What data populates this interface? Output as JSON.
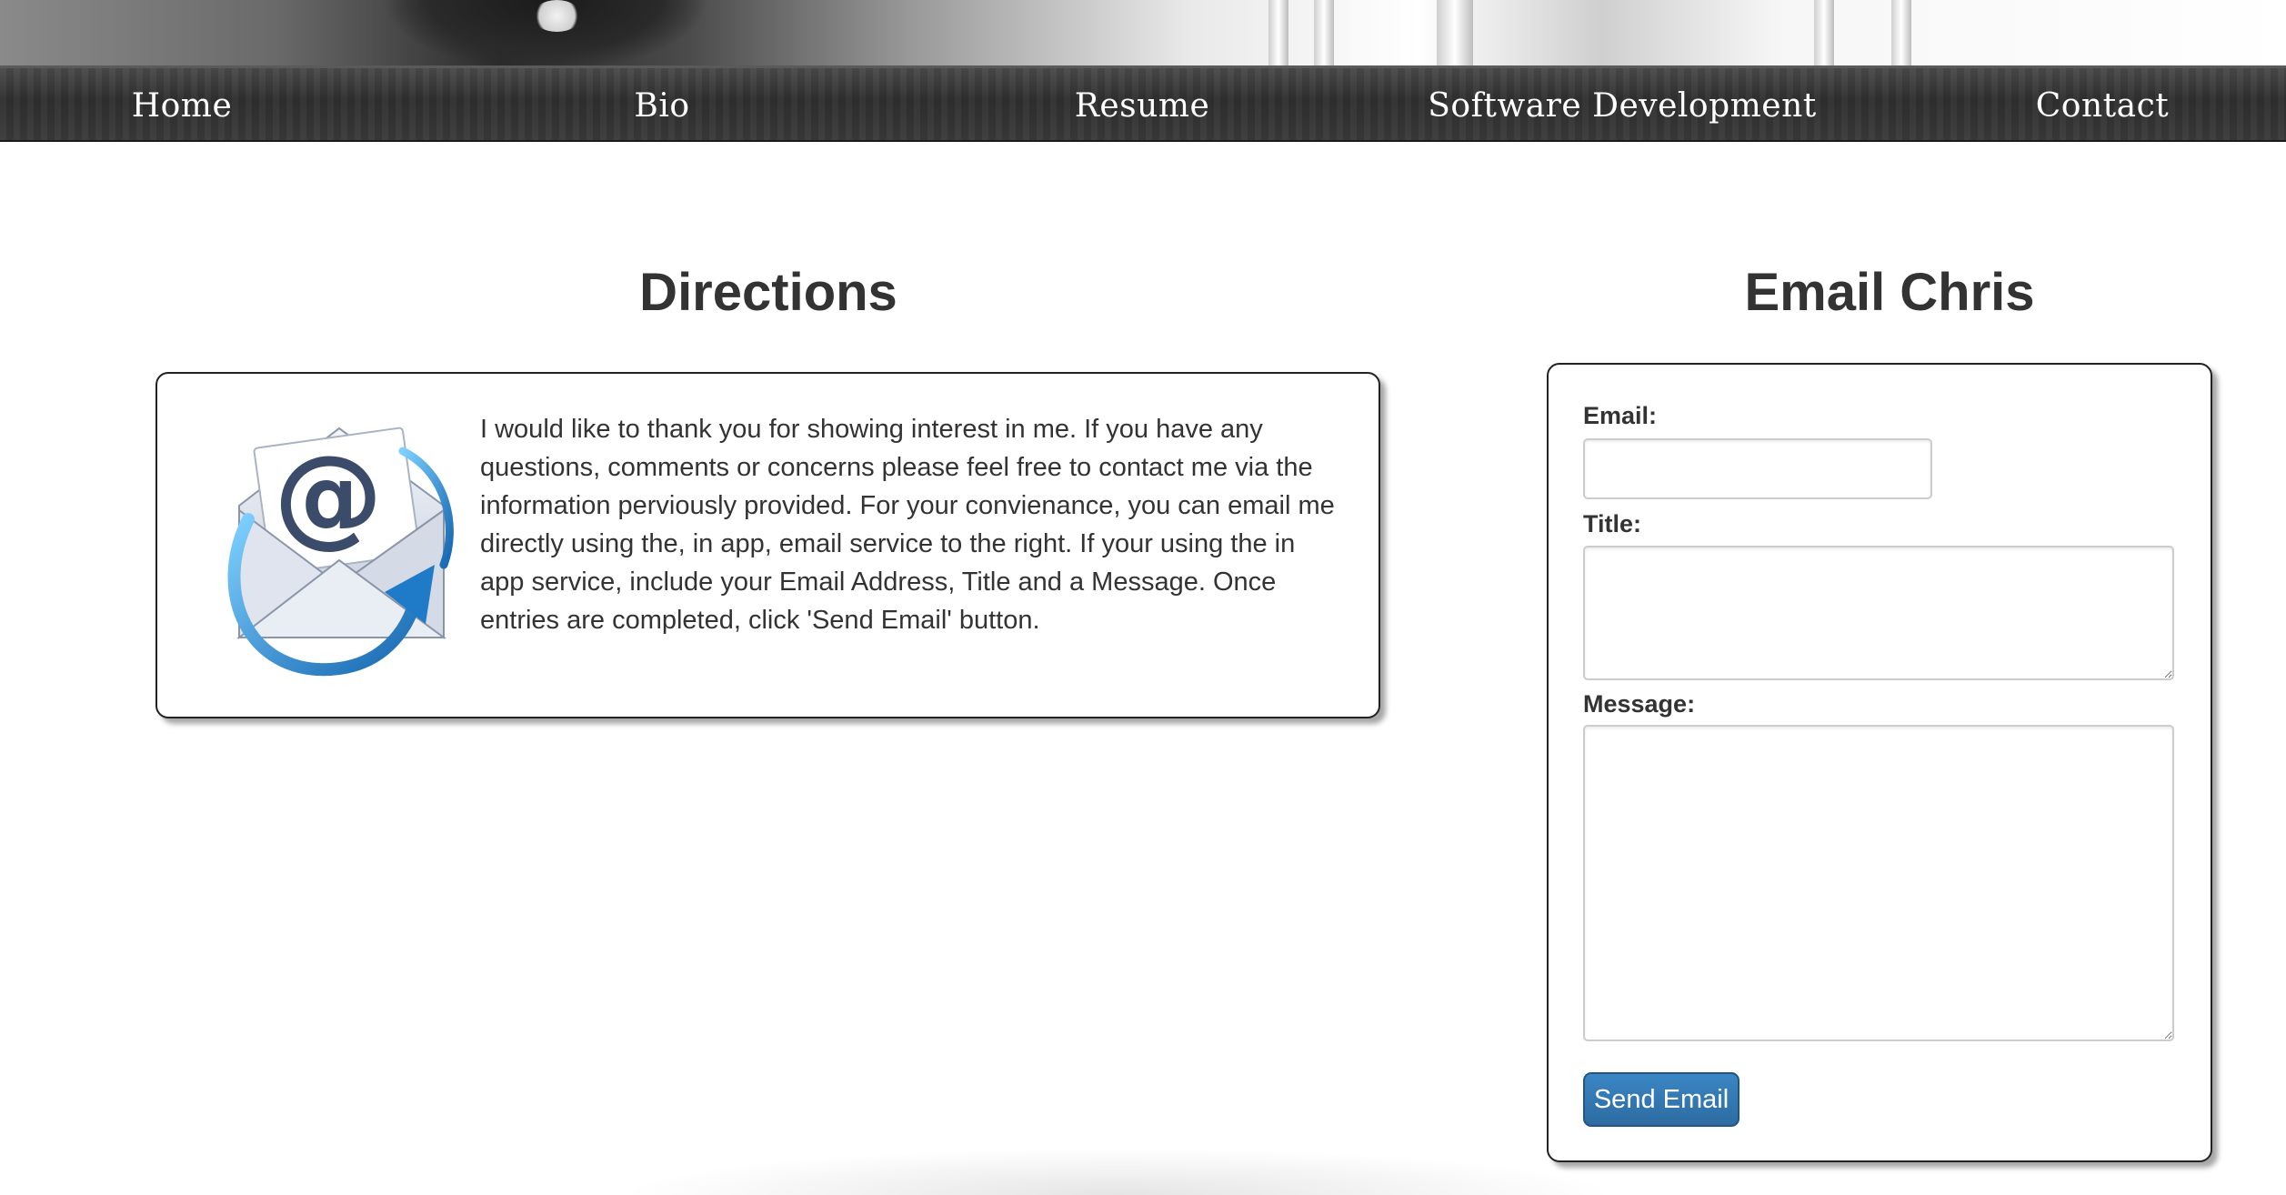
{
  "nav": {
    "items": [
      {
        "label": "Home"
      },
      {
        "label": "Bio"
      },
      {
        "label": "Resume"
      },
      {
        "label": "Software Development"
      },
      {
        "label": "Contact"
      }
    ]
  },
  "directions": {
    "title": "Directions",
    "icon": "email-envelope-icon",
    "text": "I would like to thank you for showing interest in me. If you have any questions, comments or concerns please feel free to contact me via the information perviously provided. For your convienance, you can email me directly using the, in app, email service to the right. If your using the in app service, include your Email Address, Title and a Message. Once entries are completed, click 'Send Email' button."
  },
  "email_form": {
    "title": "Email Chris",
    "email_label": "Email:",
    "email_value": "",
    "title_label": "Title:",
    "title_value": "",
    "message_label": "Message:",
    "message_value": "",
    "send_label": "Send Email"
  },
  "colors": {
    "button": "#337ab7",
    "text": "#333333",
    "nav_text": "#ffffff"
  }
}
